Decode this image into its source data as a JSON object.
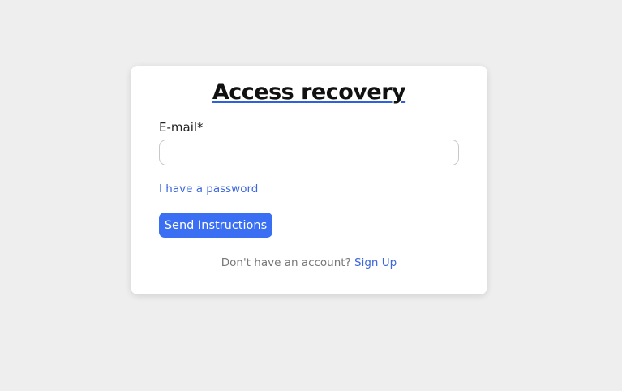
{
  "card": {
    "title": "Access recovery",
    "email_label": "E-mail*",
    "email_value": "",
    "password_link": "I have a password",
    "send_button": "Send Instructions",
    "signup_prompt": "Don't have an account?",
    "signup_link": "Sign Up"
  },
  "colors": {
    "background": "#eeeeee",
    "accent": "#3a6ff3",
    "link": "#3c66dc"
  }
}
